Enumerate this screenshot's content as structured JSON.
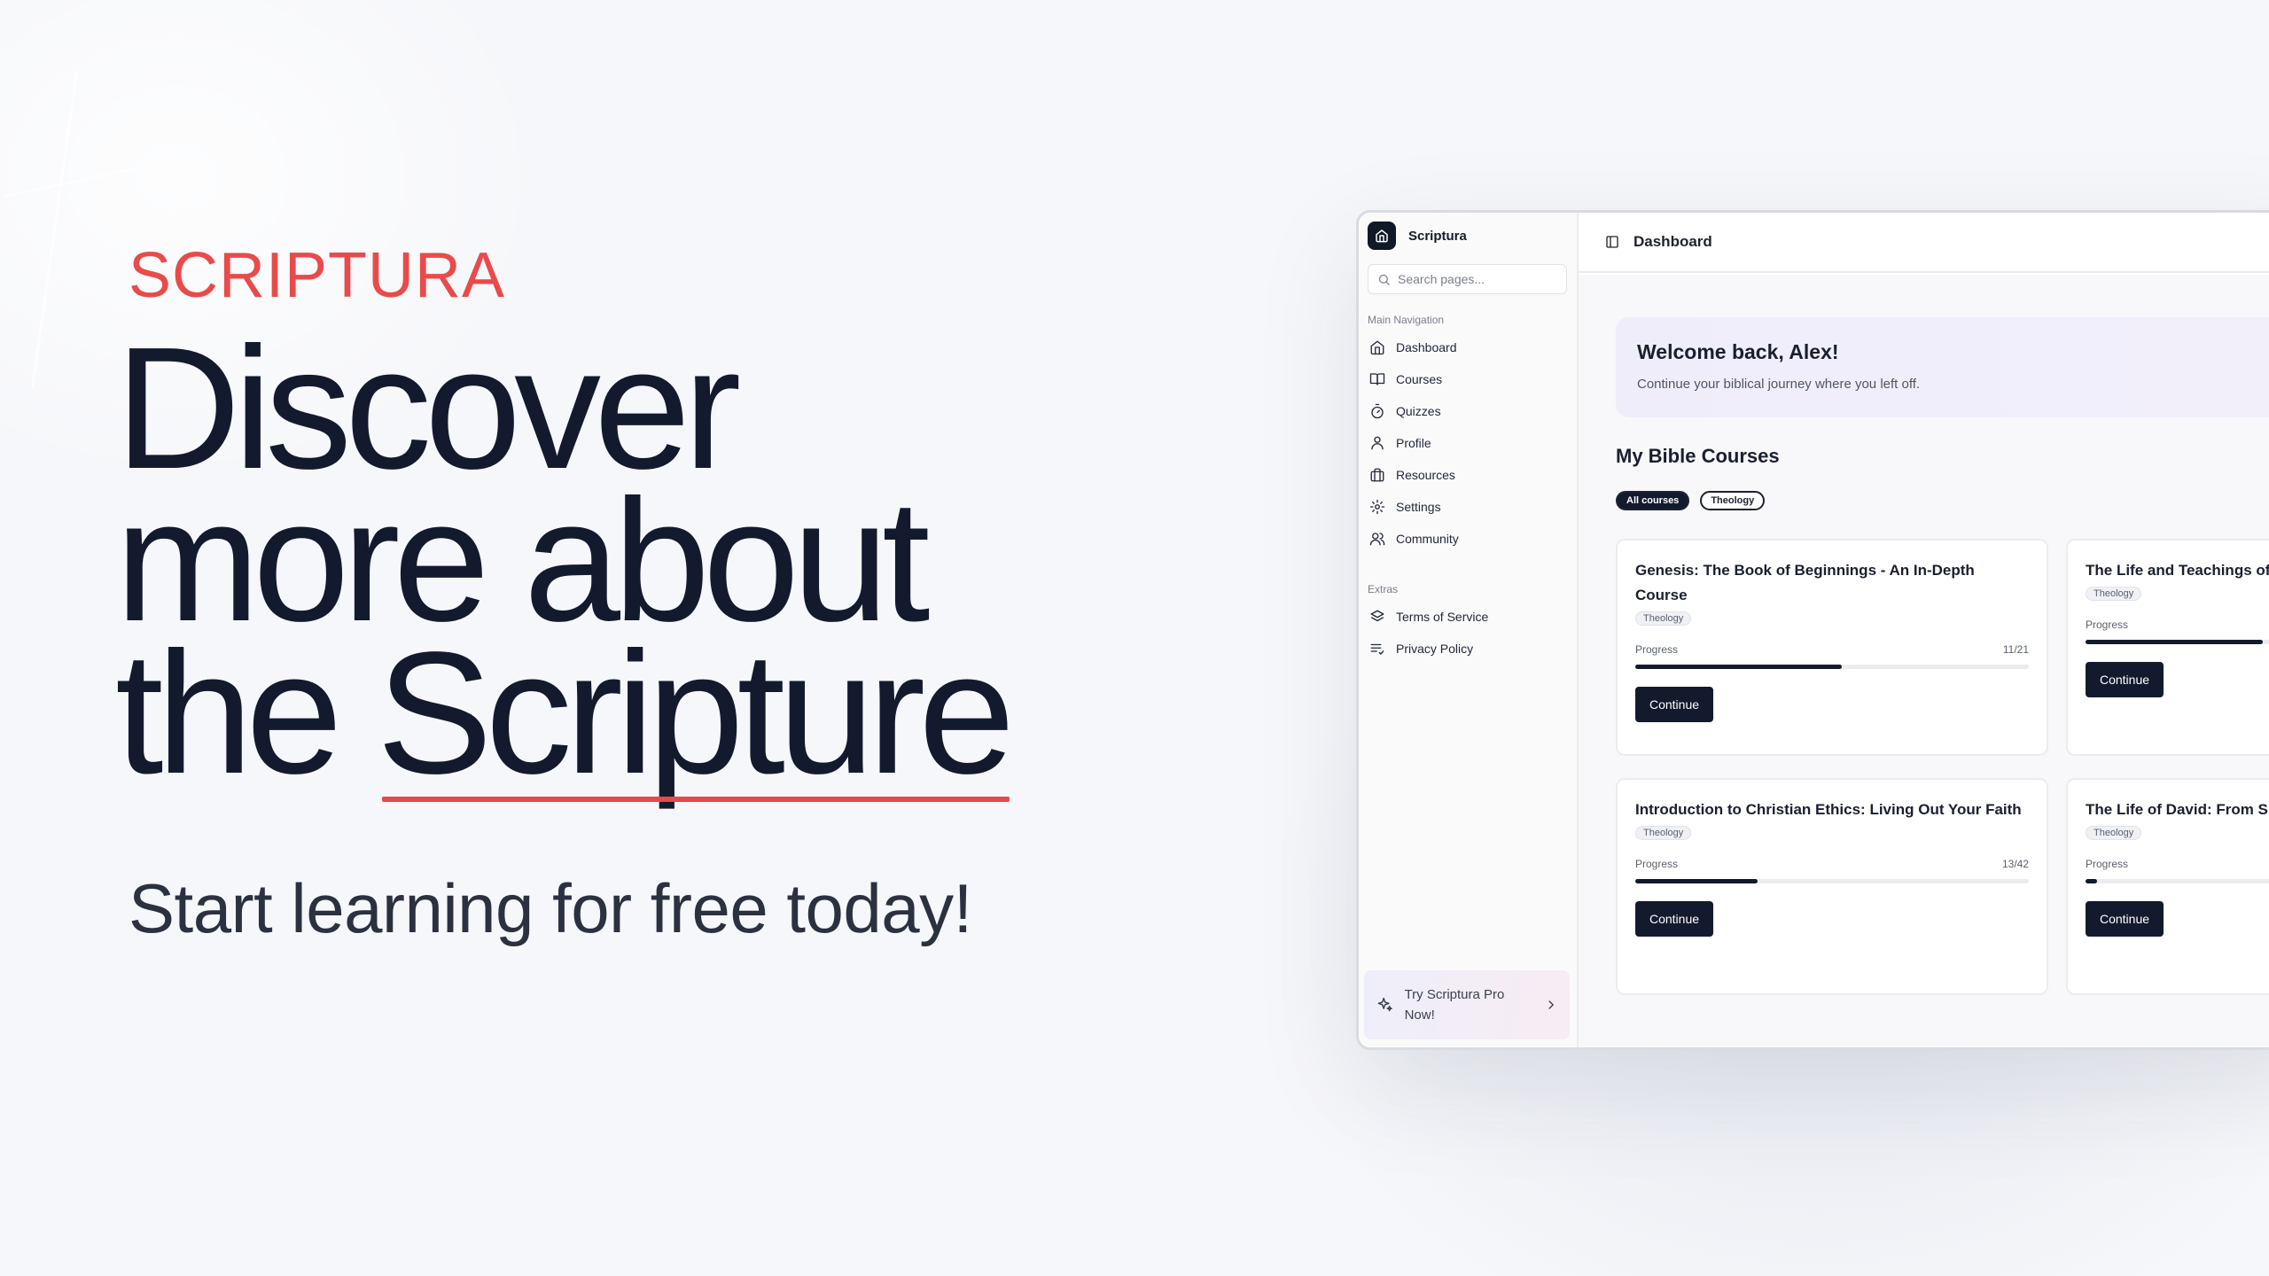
{
  "hero": {
    "brand": "SCRIPTURA",
    "headline_line1": "Discover",
    "headline_line2": "more about",
    "headline_line3_a": "the",
    "headline_line3_b": "Scripture",
    "subline": "Start learning for free today!"
  },
  "app": {
    "name": "Scriptura",
    "search_placeholder": "Search pages...",
    "main_nav_label": "Main Navigation",
    "nav": [
      {
        "label": "Dashboard",
        "icon": "home-icon"
      },
      {
        "label": "Courses",
        "icon": "book-open-icon"
      },
      {
        "label": "Quizzes",
        "icon": "timer-icon"
      },
      {
        "label": "Profile",
        "icon": "user-icon"
      },
      {
        "label": "Resources",
        "icon": "briefcase-icon"
      },
      {
        "label": "Settings",
        "icon": "gear-icon"
      },
      {
        "label": "Community",
        "icon": "users-icon"
      }
    ],
    "extras_label": "Extras",
    "extras": [
      {
        "label": "Terms of Service",
        "icon": "layers-icon"
      },
      {
        "label": "Privacy Policy",
        "icon": "list-check-icon"
      }
    ],
    "promo": "Try Scriptura Pro Now!",
    "topbar_title": "Dashboard",
    "welcome_title": "Welcome back, Alex!",
    "welcome_sub": "Continue your biblical journey where you left off.",
    "courses_title": "My Bible Courses",
    "filters": [
      "All courses",
      "Theology"
    ],
    "progress_label": "Progress",
    "continue_label": "Continue",
    "courses": [
      {
        "title": "Genesis: The Book of Beginnings - An In-Depth Course",
        "tag": "Theology",
        "count": "11/21",
        "progress": 0.524
      },
      {
        "title": "The Life and Teachings of",
        "tag": "Theology",
        "count": "",
        "progress": 0.45
      },
      {
        "title": "Introduction to Christian Ethics: Living Out Your Faith",
        "tag": "Theology",
        "count": "13/42",
        "progress": 0.31
      },
      {
        "title": "The Life of David: From S",
        "tag": "Theology",
        "count": "",
        "progress": 0.03
      }
    ]
  },
  "colors": {
    "accent_red": "#ea4a4a",
    "navy": "#141a2e"
  }
}
